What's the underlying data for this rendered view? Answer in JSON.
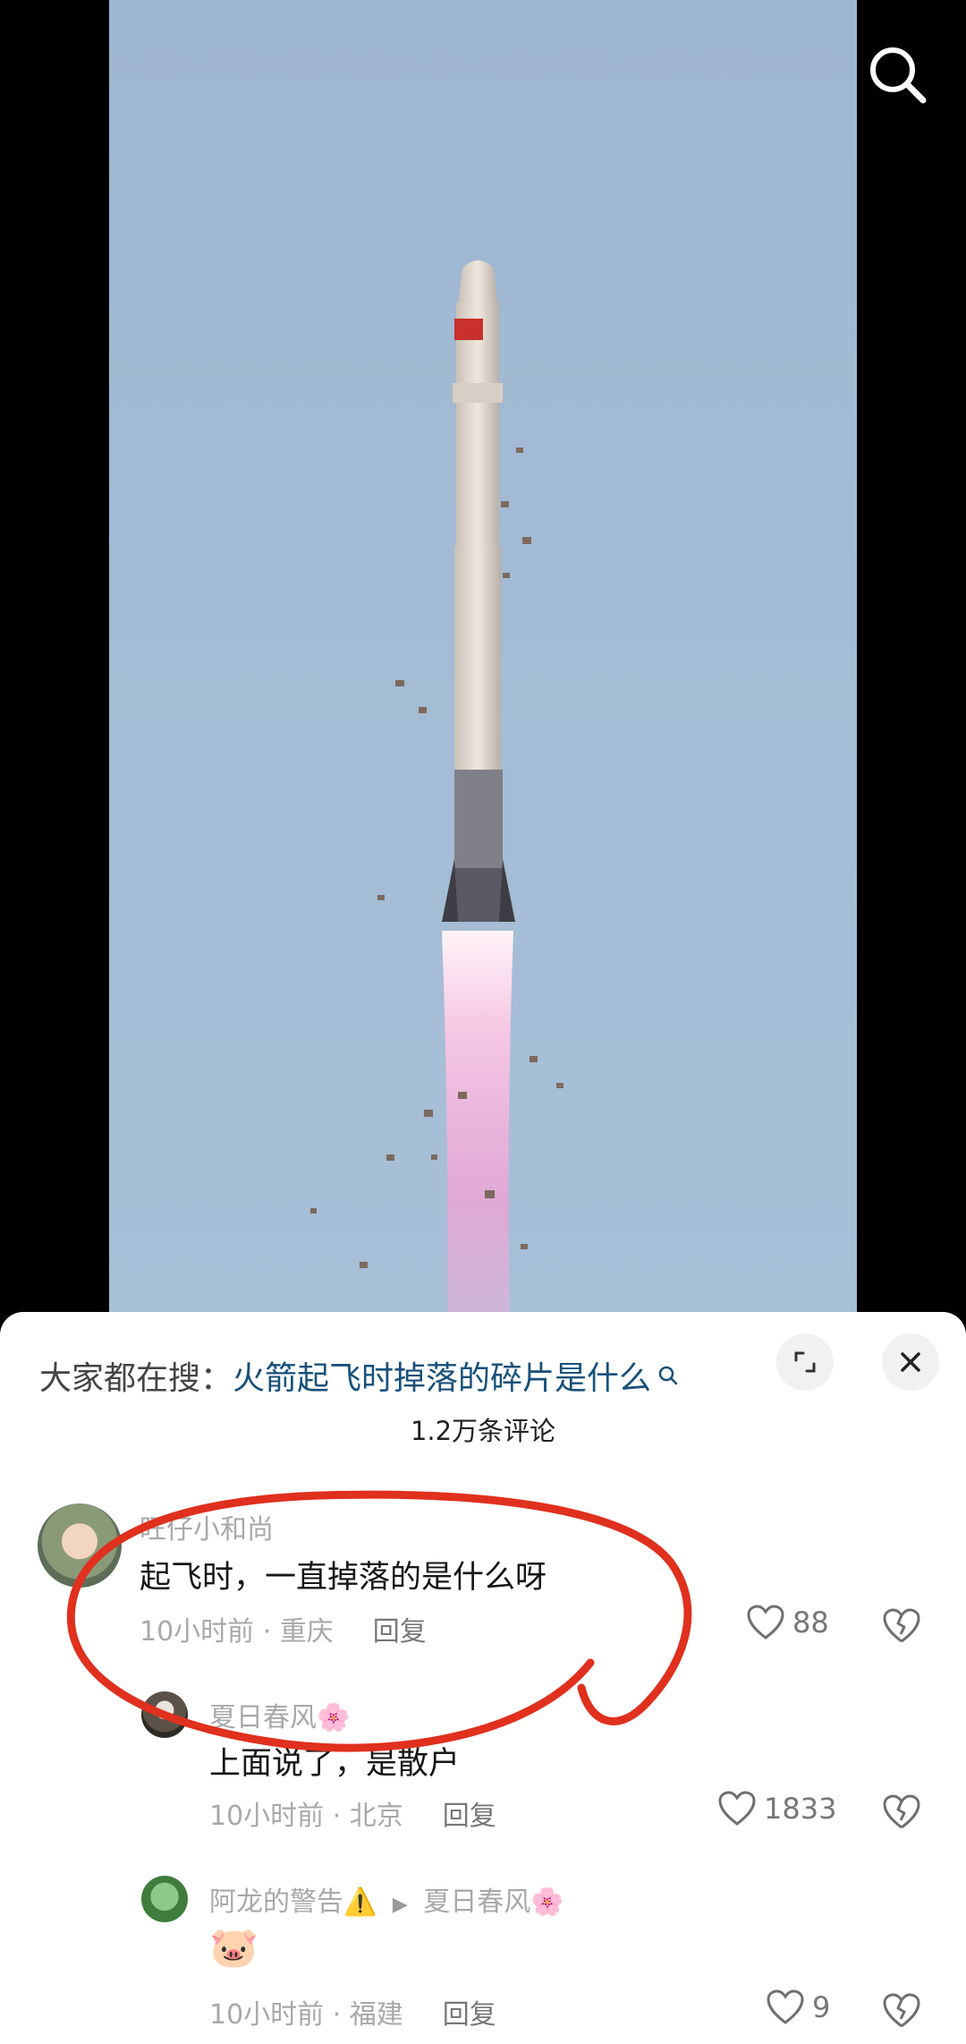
{
  "search_bar": {
    "prefix": "大家都在搜：",
    "query": "火箭起飞时掉落的碎片是什么"
  },
  "comment_count": "1.2万条评论",
  "comments": [
    {
      "user": "旺仔小和尚",
      "text": "起飞时，一直掉落的是什么呀",
      "time": "10小时前",
      "location": "重庆",
      "reply": "回复",
      "likes": "88"
    },
    {
      "user": "夏日春风🌸",
      "text": "上面说了，是散户",
      "time": "10小时前",
      "location": "北京",
      "reply": "回复",
      "likes": "1833"
    },
    {
      "user": "阿龙的警告⚠️",
      "reply_to": "夏日春风🌸",
      "text": "🐷",
      "time": "10小时前",
      "location": "福建",
      "reply": "回复",
      "likes": "9"
    }
  ],
  "meta_separator": " · ",
  "colors": {
    "link": "#18507a",
    "annotation": "#e0301e",
    "sky": "#a3bbd4"
  },
  "icons": [
    "search-icon",
    "expand-icon",
    "close-icon",
    "heart-icon",
    "broken-heart-icon",
    "reply-arrow-icon"
  ]
}
